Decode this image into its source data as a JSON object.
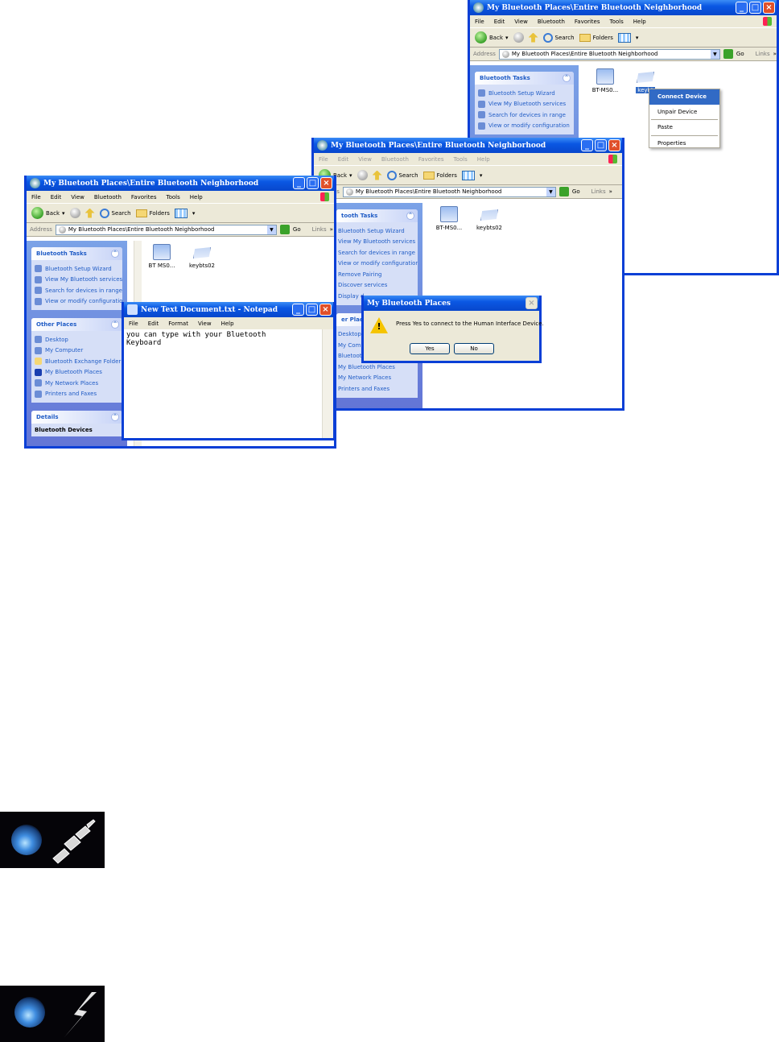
{
  "colors": {
    "titlebar": "#0a57e3",
    "taskpane": "#6375d6",
    "link": "#215dc6",
    "selection": "#316ac5",
    "warning": "#f5c400"
  },
  "explorer": {
    "title": "My Bluetooth Places\\Entire Bluetooth Neighborhood",
    "menu": [
      "File",
      "Edit",
      "View",
      "Bluetooth",
      "Favorites",
      "Tools",
      "Help"
    ],
    "toolbar": {
      "back": "Back",
      "search": "Search",
      "folders": "Folders"
    },
    "address_label": "Address",
    "address_value": "My Bluetooth Places\\Entire Bluetooth Neighborhood",
    "go": "Go",
    "links": "Links",
    "tasks_header": "Bluetooth Tasks",
    "tasks": [
      "Bluetooth Setup Wizard",
      "View My Bluetooth services",
      "Search for devices in range",
      "View or modify configuration",
      "Remove Pairing",
      "Discover services",
      "Display d"
    ],
    "other_places_header": "Other Places",
    "other_places": [
      "Desktop",
      "My Computer",
      "Bluetooth Exchange Folder",
      "My Bluetooth Places",
      "My Network Places",
      "Printers and Faxes"
    ],
    "details_header": "Details",
    "details_text": "Bluetooth Devices",
    "devices": [
      "BT-MS0...",
      "keybts02"
    ],
    "device_left_label": "BT MS0...",
    "device_partial_label": "keybt"
  },
  "context_menu": {
    "items": [
      "Connect Device",
      "Unpair Device",
      "Paste",
      "Properties"
    ]
  },
  "notepad": {
    "title": "New Text Document.txt - Notepad",
    "menu": [
      "File",
      "Edit",
      "Format",
      "View",
      "Help"
    ],
    "content": "you can type with your Bluetooth\nKeyboard"
  },
  "dialog": {
    "title": "My Bluetooth Places",
    "message": "Press Yes to connect to the Human Interface Device.",
    "yes": "Yes",
    "no": "No"
  },
  "window3_partial": {
    "tasks_header": "tooth Tasks",
    "other_places_header": "er Places",
    "desktop": "Desktop",
    "my_comp": "My Comp",
    "bt_exchange": "Bluetooth Exchange Folder"
  },
  "icons": {
    "tray_connected": "bluetooth-connected-plug-icon",
    "tray_active": "bluetooth-active-lightning-icon"
  }
}
